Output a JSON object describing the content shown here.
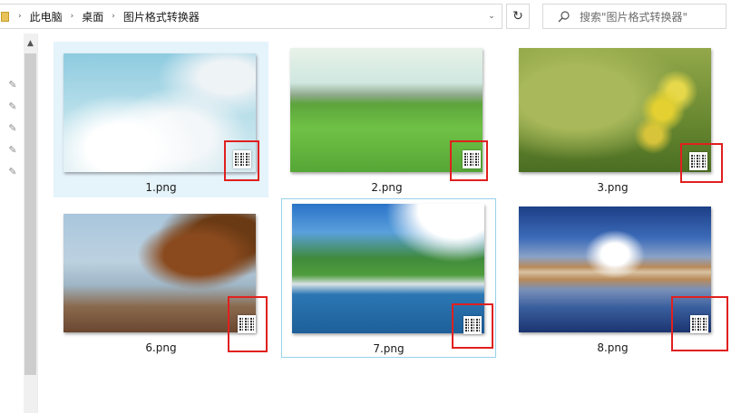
{
  "address_bar": {
    "breadcrumbs": [
      "此电脑",
      "桌面",
      "图片格式转换器"
    ]
  },
  "search": {
    "placeholder": "搜索\"图片格式转换器\""
  },
  "files": [
    {
      "name": "1.png",
      "selected": true,
      "focused": false
    },
    {
      "name": "2.png",
      "selected": false,
      "focused": false
    },
    {
      "name": "3.png",
      "selected": false,
      "focused": false
    },
    {
      "name": "6.png",
      "selected": false,
      "focused": false
    },
    {
      "name": "7.png",
      "selected": false,
      "focused": true
    },
    {
      "name": "8.png",
      "selected": false,
      "focused": false
    }
  ],
  "colors": {
    "selection": "#e5f3fb",
    "focus_border": "#99d1ea",
    "highlight_box": "#e0201f"
  },
  "icons": {
    "folder": "folder-icon",
    "pin": "pin-icon",
    "refresh": "refresh-icon",
    "search": "search-icon",
    "dropdown": "chevron-down-icon",
    "scroll_up": "chevron-up-icon"
  }
}
